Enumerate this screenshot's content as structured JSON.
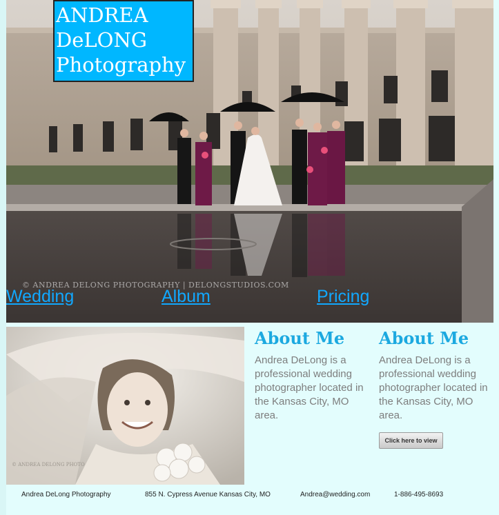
{
  "logo": {
    "line1": "ANDREA",
    "line2": "DeLONG",
    "line3": "Photography"
  },
  "hero": {
    "watermark": "© ANDREA DELONG PHOTOGRAPHY | DELONGSTUDIOS.COM"
  },
  "nav": {
    "wedding": "Wedding",
    "album": "Album",
    "pricing": "Pricing"
  },
  "bride_photo": {
    "watermark": "© ANDREA DELONG PHOTO"
  },
  "about": [
    {
      "title": "About Me",
      "text": "Andrea DeLong is a professional wedding photographer located in the Kansas City, MO area."
    },
    {
      "title": "About Me",
      "text": "Andrea DeLong is a professional wedding photographer located in the Kansas City, MO area."
    }
  ],
  "button": {
    "view_label": "Click here to view"
  },
  "footer": {
    "name": "Andrea DeLong Photography",
    "address": "855 N. Cypress Avenue Kansas City, MO",
    "email": "Andrea@wedding.com",
    "phone": "1-886-495-8693"
  },
  "colors": {
    "logo_bg": "#00b7ff",
    "link": "#11a8ff",
    "heading": "#1ca9e0",
    "page_bg": "#e3fdfd"
  }
}
